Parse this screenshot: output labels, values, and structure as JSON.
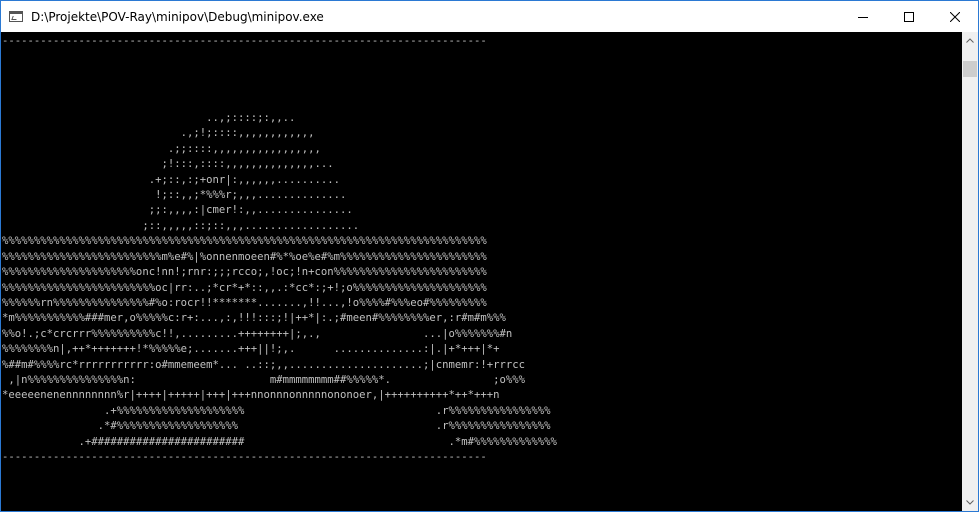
{
  "window": {
    "title": "D:\\Projekte\\POV-Ray\\minipov\\Debug\\minipov.exe",
    "controls": {
      "minimize": "minimize",
      "maximize": "maximize",
      "close": "close"
    }
  },
  "console": {
    "foreground": "#c0c0c0",
    "background": "#000000",
    "lines": [
      "----------------------------------------------------------------------------",
      "",
      "",
      "",
      "",
      "                                ..,;::::;:,,..",
      "                            .,;!;::::,,,,,,,,,,,,",
      "                          .;;::::,,,,,,,,,,,,,,,,,",
      "                         ;!:::,::::,,,,,,,,,,,,,,...",
      "                       .+;::,:;+onr|:,,,,,,..........",
      "                        !;::,,;*%%%r;,,,..............",
      "                       ;;:,,,,:|cmer!:,,...............",
      "                      ;::,,,,,::;::,,,..................",
      "%%%%%%%%%%%%%%%%%%%%%%%%%%%%%%%%%%%%%%%%%%%%%%%%%%%%%%%%%%%%%%%%%%%%%%%%%%%%",
      "%%%%%%%%%%%%%%%%%%%%%%%%%m%e#%|%onnenmoeen#%*%oe%e#%m%%%%%%%%%%%%%%%%%%%%%%%",
      "%%%%%%%%%%%%%%%%%%%%%onc!nn!;rnr:;;;rcco;,!oc;!n+con%%%%%%%%%%%%%%%%%%%%%%%%",
      "%%%%%%%%%%%%%%%%%%%%%%%%oc|rr:..;*cr*+*::,,.:*cc*:;+!;o%%%%%%%%%%%%%%%%%%%%%",
      "%%%%%%rn%%%%%%%%%%%%%%%#%o:rocr!!*******.......,!!...,!o%%%%#%%%eo#%%%%%%%%%",
      "*m%%%%%%%%%%%###mer,o%%%%%c:r+:...,:,!!!:::;!|++*|:.;#meen#%%%%%%%%er,:r#m#m%%%",
      "%%o!.;c*crcrrr%%%%%%%%%%c!!,.........++++++++|;,.,                ...|o%%%%%%%#n",
      "%%%%%%%%n|,++*+++++++!*%%%%%e;.......+++||!;,.      ..............:|.|+*+++|*+",
      "%##m#%%%%rc*rrrrrrrrrrr:o#mmemeem*... ..::;,,.....................;|cnmemr:!+rrrcc",
      " ,|n%%%%%%%%%%%%%%%n:                     m#mmmmmmmm##%%%%%*.                ;o%%%",
      "*eeeeenenennnnnnnn%r|++++|+++++|+++|+++nnonnnonnnnnononoer,|++++++++++*++*+++n",
      "                .+%%%%%%%%%%%%%%%%%%%%                              .r%%%%%%%%%%%%%%%%",
      "               .*#%%%%%%%%%%%%%%%%%%%                               .r%%%%%%%%%%%%%%%%",
      "            .+########################                                .*m#%%%%%%%%%%%%%",
      "----------------------------------------------------------------------------"
    ]
  },
  "scrollbar": {
    "up": "scroll-up",
    "down": "scroll-down"
  }
}
